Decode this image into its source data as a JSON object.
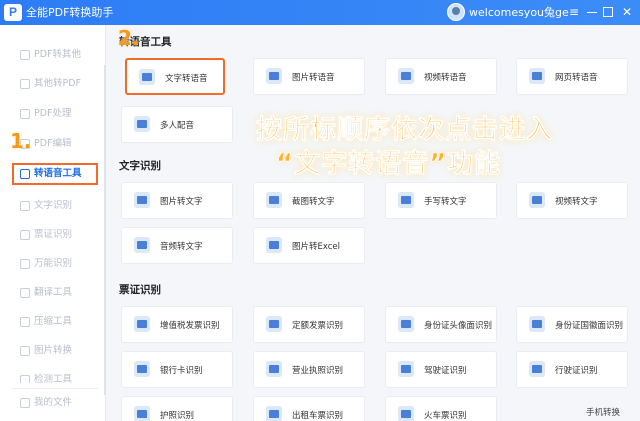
{
  "app": {
    "title": "全能PDF转换助手",
    "logo_char": "P"
  },
  "user": {
    "name": "welcomesyou兔ge"
  },
  "window": {
    "minimize_icon": "minimize-icon",
    "maximize_icon": "maximize-icon",
    "close_icon": "close-icon",
    "close_glyph": "✕",
    "menu_glyph": "≡"
  },
  "sidebar": {
    "items": [
      {
        "label": "PDF转其他"
      },
      {
        "label": "其他转PDF"
      },
      {
        "label": "PDF处理"
      },
      {
        "label": "PDF编辑"
      },
      {
        "label": "转语音工具"
      },
      {
        "label": "文字识别"
      },
      {
        "label": "票证识别"
      },
      {
        "label": "万能识别"
      },
      {
        "label": "翻译工具"
      },
      {
        "label": "压缩工具"
      },
      {
        "label": "图片转换"
      },
      {
        "label": "检测工具"
      }
    ],
    "my_files": "我的文件",
    "active_index": 4,
    "markers": {
      "sidebar": "1.",
      "card": "2."
    }
  },
  "sections": [
    {
      "title": "转语音工具",
      "cards": [
        {
          "label": "文字转语音",
          "icon": "text-to-speech-icon"
        },
        {
          "label": "图片转语音",
          "icon": "image-to-speech-icon"
        },
        {
          "label": "视频转语音",
          "icon": "video-to-speech-icon"
        },
        {
          "label": "网页转语音",
          "icon": "webpage-to-speech-icon"
        },
        {
          "label": "多人配音",
          "icon": "multi-voice-icon"
        }
      ]
    },
    {
      "title": "文字识别",
      "cards": [
        {
          "label": "图片转文字",
          "icon": "image-to-text-icon"
        },
        {
          "label": "截图转文字",
          "icon": "screenshot-to-text-icon"
        },
        {
          "label": "手写转文字",
          "icon": "handwriting-to-text-icon"
        },
        {
          "label": "视频转文字",
          "icon": "video-to-text-icon"
        },
        {
          "label": "音频转文字",
          "icon": "audio-to-text-icon"
        },
        {
          "label": "图片转Excel",
          "icon": "image-to-excel-icon"
        }
      ]
    },
    {
      "title": "票证识别",
      "cards": [
        {
          "label": "增值税发票识别",
          "icon": "vat-invoice-icon"
        },
        {
          "label": "定额发票识别",
          "icon": "fixed-invoice-icon"
        },
        {
          "label": "身份证头像面识别",
          "icon": "id-card-front-icon"
        },
        {
          "label": "身份证国徽面识别",
          "icon": "id-card-back-icon"
        },
        {
          "label": "银行卡识别",
          "icon": "bank-card-icon"
        },
        {
          "label": "营业执照识别",
          "icon": "business-license-icon"
        },
        {
          "label": "驾驶证识别",
          "icon": "driver-license-icon"
        },
        {
          "label": "行驶证识别",
          "icon": "vehicle-license-icon"
        },
        {
          "label": "护照识别",
          "icon": "passport-icon"
        },
        {
          "label": "出租车票识别",
          "icon": "taxi-receipt-icon"
        },
        {
          "label": "火车票识别",
          "icon": "train-ticket-icon"
        }
      ]
    }
  ],
  "overlay": {
    "line1": "按所标顺序依次点击进入",
    "line2": "“文字转语音”功能"
  },
  "mobile_link": "手机转换",
  "colors": {
    "accent": "#2d7cf5",
    "highlight": "#f26b2a",
    "overlay": "#ffb22e"
  }
}
